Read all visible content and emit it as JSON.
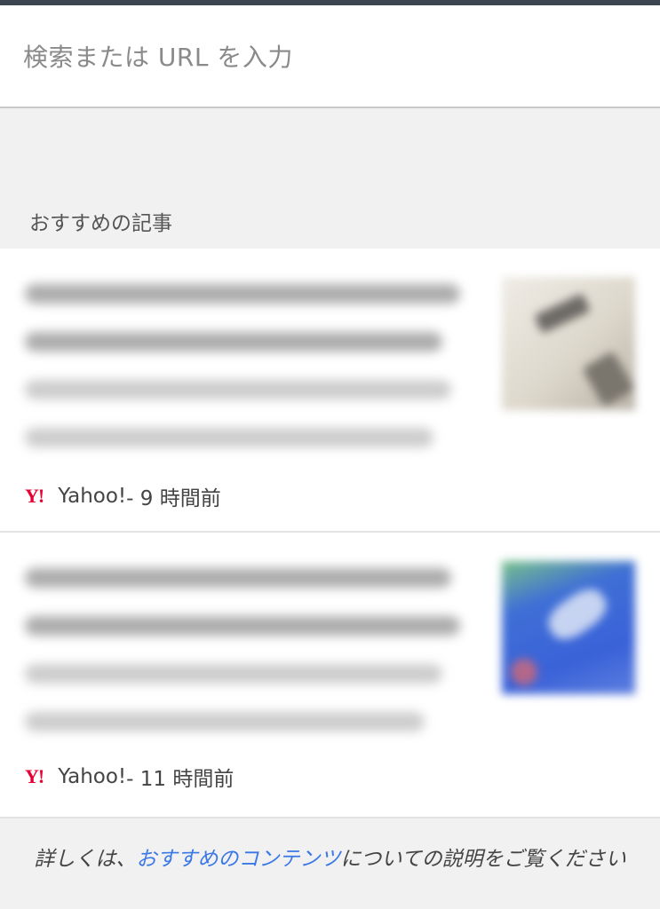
{
  "omnibox": {
    "placeholder": "検索または URL を入力"
  },
  "section": {
    "title": "おすすめの記事"
  },
  "articles": [
    {
      "source": "Yahoo!",
      "time": " - 9 時間前"
    },
    {
      "source": "Yahoo!",
      "time": " - 11 時間前"
    }
  ],
  "footer": {
    "prefix": "詳しくは、",
    "link": "おすすめのコンテンツ",
    "suffix": "についての説明をご覧ください"
  },
  "colors": {
    "yahoo_red": "#e60033",
    "link_blue": "#3b78e7"
  }
}
